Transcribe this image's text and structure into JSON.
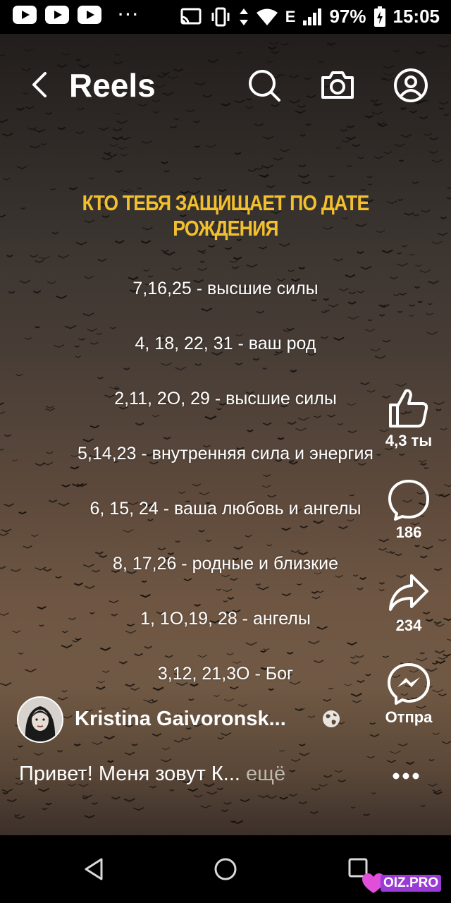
{
  "status_bar": {
    "battery": "97%",
    "time": "15:05",
    "network": "E",
    "more": "···"
  },
  "header": {
    "title": "Reels"
  },
  "reel": {
    "title": "КТО ТЕБЯ ЗАЩИЩАЕТ ПО ДАТЕ РОЖДЕНИЯ",
    "lines": [
      "7,16,25 - высшие силы",
      "4, 18, 22, 31 - ваш род",
      "2,11, 2O, 29 - высшие силы",
      "5,14,23 - внутренняя сила и энергия",
      "6, 15, 24 - ваша любовь и ангелы",
      "8, 17,26 - родные и близкие",
      "1, 1O,19, 28 - ангелы",
      "3,12, 21,3O - Бог"
    ]
  },
  "actions": {
    "likes": "4,3 ты",
    "comments": "186",
    "shares": "234",
    "send": "Отпра"
  },
  "author": {
    "name": "Kristina Gaivoronsk..."
  },
  "caption": {
    "text": "Привет! Меня зовут К...",
    "more": "ещё"
  },
  "watermark": {
    "text": "OIZ.PRO"
  },
  "colors": {
    "title_yellow": "#f2c02e",
    "background_dark": "#000000",
    "watermark_purple": "#9b3bd6"
  }
}
